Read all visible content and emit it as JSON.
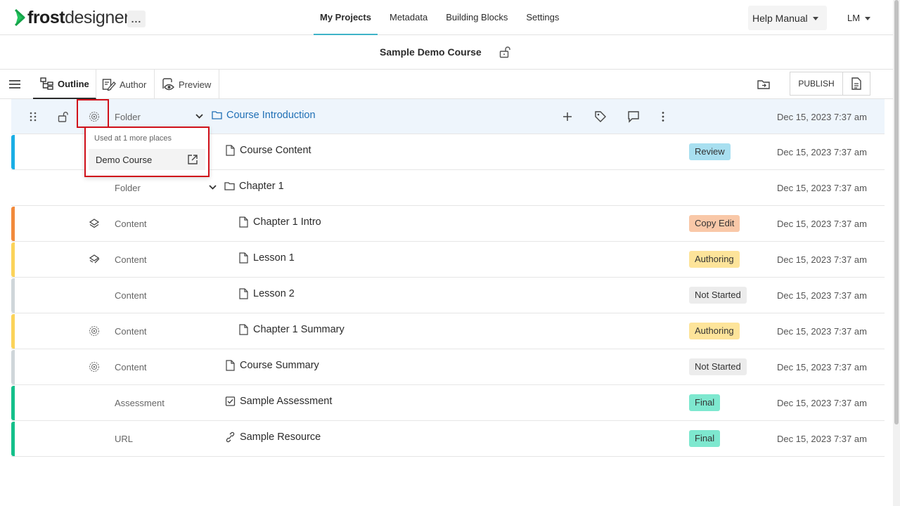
{
  "brand": {
    "logo_frost": "frost",
    "logo_designer": "designer",
    "accent": "#3fb3c8"
  },
  "topbar": {
    "more_label": "...",
    "nav": [
      {
        "label": "My Projects",
        "active": true
      },
      {
        "label": "Metadata",
        "active": false
      },
      {
        "label": "Building Blocks",
        "active": false
      },
      {
        "label": "Settings",
        "active": false
      }
    ],
    "help_label": "Help Manual",
    "user_initials": "LM"
  },
  "course": {
    "title": "Sample Demo Course"
  },
  "toolbar": {
    "tabs": [
      {
        "label": "Outline",
        "active": true
      },
      {
        "label": "Author",
        "active": false
      },
      {
        "label": "Preview",
        "active": false
      }
    ],
    "publish_label": "PUBLISH"
  },
  "rows": [
    {
      "type": "Folder",
      "title": "Course Introduction",
      "icon": "folder-icon",
      "badge": "",
      "date": "Dec 15, 2023 7:37 am",
      "bar_color": ""
    },
    {
      "type": "",
      "title": "Course Content",
      "icon": "file-icon",
      "badge": "Review",
      "badge_color": "#a8dff0",
      "date": "Dec 15, 2023 7:37 am",
      "bar_color": "#1aaee5"
    },
    {
      "type": "Folder",
      "title": "Chapter 1",
      "icon": "folder-icon",
      "badge": "",
      "date": "Dec 15, 2023 7:37 am",
      "bar_color": ""
    },
    {
      "type": "Content",
      "title": "Chapter 1 Intro",
      "icon": "file-icon",
      "badge": "Copy Edit",
      "badge_color": "#f9c8a8",
      "date": "Dec 15, 2023 7:37 am",
      "bar_color": "#f28a3c"
    },
    {
      "type": "Content",
      "title": "Lesson 1",
      "icon": "file-icon",
      "badge": "Authoring",
      "badge_color": "#fde49a",
      "date": "Dec 15, 2023 7:37 am",
      "bar_color": "#fbd35a"
    },
    {
      "type": "Content",
      "title": "Lesson 2",
      "icon": "file-icon",
      "badge": "Not Started",
      "badge_color": "#ececec",
      "date": "Dec 15, 2023 7:37 am",
      "bar_color": "#cfd6da"
    },
    {
      "type": "Content",
      "title": "Chapter 1 Summary",
      "icon": "file-icon",
      "badge": "Authoring",
      "badge_color": "#fde49a",
      "date": "Dec 15, 2023 7:37 am",
      "bar_color": "#fbd35a"
    },
    {
      "type": "Content",
      "title": "Course Summary",
      "icon": "file-icon",
      "badge": "Not Started",
      "badge_color": "#ececec",
      "date": "Dec 15, 2023 7:37 am",
      "bar_color": "#cfd6da"
    },
    {
      "type": "Assessment",
      "title": "Sample Assessment",
      "icon": "checkbox-icon",
      "badge": "Final",
      "badge_color": "#7ee8cf",
      "date": "Dec 15, 2023 7:37 am",
      "bar_color": "#14c08a"
    },
    {
      "type": "URL",
      "title": "Sample Resource",
      "icon": "link-icon",
      "badge": "Final",
      "badge_color": "#7ee8cf",
      "date": "Dec 15, 2023 7:37 am",
      "bar_color": "#14c08a"
    }
  ],
  "popup": {
    "heading": "Used at 1 more places",
    "item_label": "Demo Course"
  }
}
